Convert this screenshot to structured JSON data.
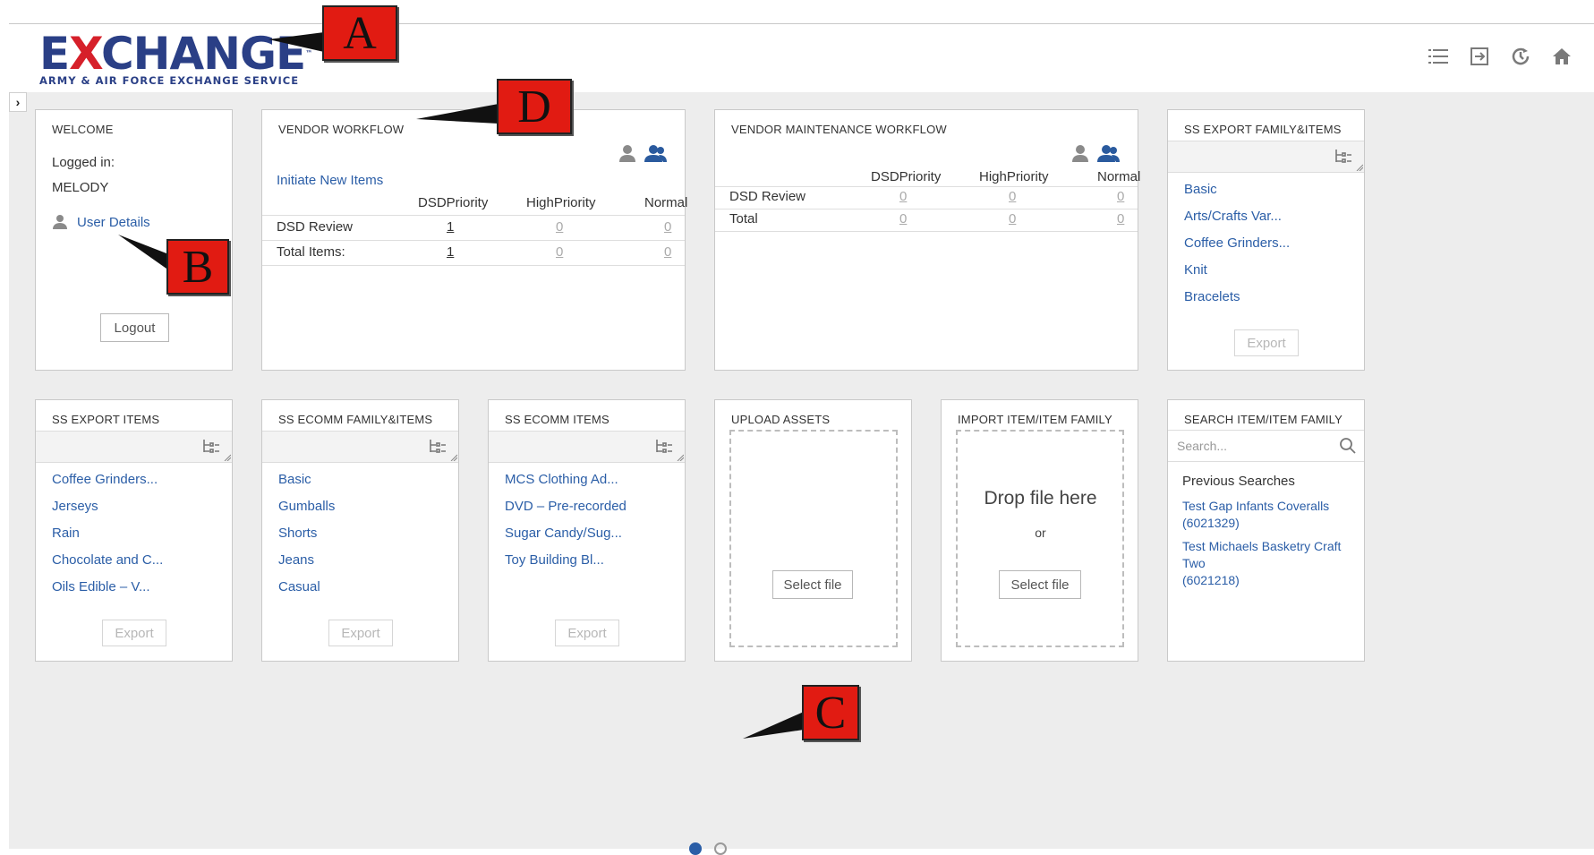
{
  "header": {
    "logo_main": "EXCHANGE",
    "logo_sub": "ARMY & AIR FORCE EXCHANGE SERVICE",
    "icons": [
      "list-icon",
      "sign-out-icon",
      "history-icon",
      "home-icon"
    ]
  },
  "welcome": {
    "title": "WELCOME",
    "logged_in_label": "Logged in:",
    "username": "MELODY",
    "user_details": "User Details",
    "logout": "Logout"
  },
  "vendor_workflow": {
    "title": "VENDOR WORKFLOW",
    "initiate_link": "Initiate New Items",
    "columns": [
      "DSDPriority",
      "HighPriority",
      "Normal"
    ],
    "rows": [
      {
        "label": "DSD Review",
        "values": [
          "1",
          "0",
          "0"
        ]
      },
      {
        "label": "Total Items:",
        "values": [
          "1",
          "0",
          "0"
        ]
      }
    ]
  },
  "vendor_maintenance": {
    "title": "VENDOR MAINTENANCE WORKFLOW",
    "columns": [
      "DSDPriority",
      "HighPriority",
      "Normal"
    ],
    "rows": [
      {
        "label": "DSD Review",
        "values": [
          "0",
          "0",
          "0"
        ]
      },
      {
        "label": "Total",
        "values": [
          "0",
          "0",
          "0"
        ]
      }
    ]
  },
  "ss_export_family": {
    "title": "SS EXPORT FAMILY&ITEMS",
    "items": [
      "Basic",
      "Arts/Crafts Var...",
      "Coffee Grinders...",
      "Knit",
      "Bracelets"
    ],
    "export": "Export"
  },
  "ss_export_items": {
    "title": "SS EXPORT ITEMS",
    "items": [
      "Coffee Grinders...",
      "Jerseys",
      "Rain",
      "Chocolate and C...",
      "Oils Edible – V..."
    ],
    "export": "Export"
  },
  "ss_ecomm_family": {
    "title": "SS ECOMM FAMILY&ITEMS",
    "items": [
      "Basic",
      "Gumballs",
      "Shorts",
      "Jeans",
      "Casual"
    ],
    "export": "Export"
  },
  "ss_ecomm_items": {
    "title": "SS ECOMM ITEMS",
    "items": [
      "MCS Clothing Ad...",
      "DVD – Pre-recorded",
      "Sugar Candy/Sug...",
      "Toy Building Bl..."
    ],
    "export": "Export"
  },
  "upload_assets": {
    "title": "UPLOAD ASSETS",
    "select_file": "Select file"
  },
  "import_item": {
    "title": "IMPORT ITEM/ITEM FAMILY",
    "drop_text": "Drop file here",
    "or_text": "or",
    "select_file": "Select file"
  },
  "search_item": {
    "title": "SEARCH ITEM/ITEM FAMILY",
    "placeholder": "Search...",
    "previous_label": "Previous Searches",
    "previous": [
      {
        "name": "Test Gap Infants Coveralls",
        "id": "(6021329)"
      },
      {
        "name": "Test Michaels Basketry Craft Two",
        "id": "(6021218)"
      }
    ]
  },
  "annotations": {
    "a": "A",
    "b": "B",
    "c": "C",
    "d": "D"
  },
  "colors": {
    "link": "#2b5ea7",
    "annotation": "#e11b12",
    "brand_blue": "#2a3f86",
    "brand_red": "#d6202a"
  }
}
